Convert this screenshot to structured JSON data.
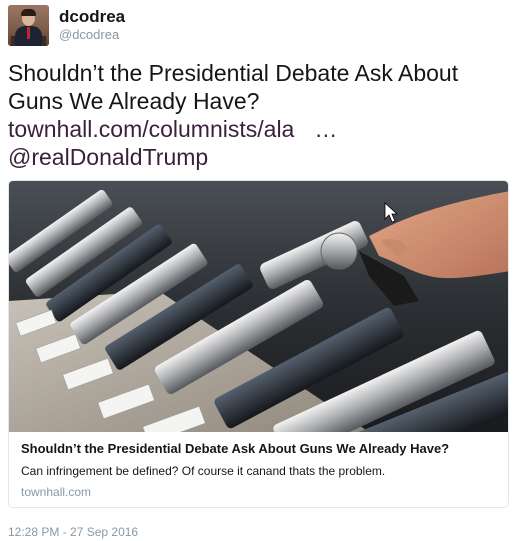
{
  "user": {
    "display_name": "dcodrea",
    "handle": "@dcodrea"
  },
  "tweet": {
    "text": "Shouldn’t the Presidential Debate Ask About Guns We Already Have?",
    "link_text": "townhall.com/columnists/ala",
    "ellipsis": "…",
    "mention": "@realDonaldTrump"
  },
  "card": {
    "image_icon": "gun-display-photo",
    "title": "Shouldn’t the Presidential Debate Ask About Guns We Already Have?",
    "description": "Can infringement be defined? Of course it canand thats the problem.",
    "domain": "townhall.com"
  },
  "timestamp": "12:28 PM - 27 Sep 2016"
}
